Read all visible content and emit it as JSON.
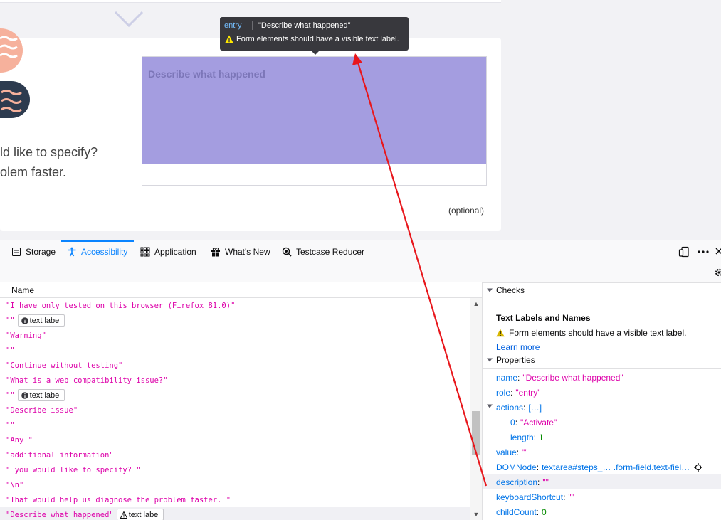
{
  "tooltip": {
    "role": "entry",
    "name": "\"Describe what happened\"",
    "warning": "Form elements should have a visible text label."
  },
  "page": {
    "question_line1": "ld like to specify?",
    "question_line2": "olem faster.",
    "textarea_placeholder": "Describe what happened",
    "optional_label": "(optional)"
  },
  "devtools": {
    "tabs": [
      {
        "label": "Storage",
        "icon": "storage-icon"
      },
      {
        "label": "Accessibility",
        "icon": "accessibility-icon"
      },
      {
        "label": "Application",
        "icon": "application-icon"
      },
      {
        "label": "What's New",
        "icon": "gift-icon"
      },
      {
        "label": "Testcase Reducer",
        "icon": "bug-search-icon"
      }
    ],
    "tree_header": "Name",
    "tree_rows": [
      {
        "text": "\"I have only tested on this browser (Firefox 81.0)\"",
        "badge": ""
      },
      {
        "text": "\"\"",
        "badge": "text label",
        "badge_icon": "info"
      },
      {
        "text": "\"Warning\"",
        "badge": ""
      },
      {
        "text": "\"\"",
        "badge": ""
      },
      {
        "text": "\"Continue without testing\"",
        "badge": ""
      },
      {
        "text": "\"What is a web compatibility issue?\"",
        "badge": ""
      },
      {
        "text": "\"\"",
        "badge": "text label",
        "badge_icon": "info"
      },
      {
        "text": "\"Describe issue\"",
        "badge": ""
      },
      {
        "text": "\"\"",
        "badge": ""
      },
      {
        "text": "\"Any \"",
        "badge": ""
      },
      {
        "text": "\"additional information\"",
        "badge": ""
      },
      {
        "text": "\" you would like to specify? \"",
        "badge": ""
      },
      {
        "text": "\"\\n\"",
        "badge": ""
      },
      {
        "text": "\"That would help us diagnose the problem faster. \"",
        "badge": ""
      },
      {
        "text": "\"Describe what happened\"",
        "badge": "text label",
        "badge_icon": "warning"
      }
    ],
    "checks": {
      "header": "Checks",
      "title": "Text Labels and Names",
      "warning": "Form elements should have a visible text label.",
      "learn_more": "Learn more"
    },
    "properties": {
      "header": "Properties",
      "items": [
        {
          "key": "name",
          "value": "\"Describe what happened\"",
          "kind": "s"
        },
        {
          "key": "role",
          "value": "\"entry\"",
          "kind": "s"
        },
        {
          "key": "actions",
          "value": "[…]",
          "kind": "k"
        },
        {
          "key": "0",
          "value": "\"Activate\"",
          "kind": "s"
        },
        {
          "key": "length",
          "value": "1",
          "kind": "n"
        },
        {
          "key": "value",
          "value": "\"\"",
          "kind": "s"
        },
        {
          "key": "DOMNode",
          "value": "textarea#steps_… .form-field.text-fiel…",
          "kind": "k"
        },
        {
          "key": "description",
          "value": "\"\"",
          "kind": "s"
        },
        {
          "key": "keyboardShortcut",
          "value": "\"\"",
          "kind": "s"
        },
        {
          "key": "childCount",
          "value": "0",
          "kind": "n"
        }
      ]
    }
  },
  "colors": {
    "accent": "#0a84ff",
    "highlight": "#a49de0",
    "string": "#dd00a9",
    "annotation_arrow": "#e8171c"
  }
}
